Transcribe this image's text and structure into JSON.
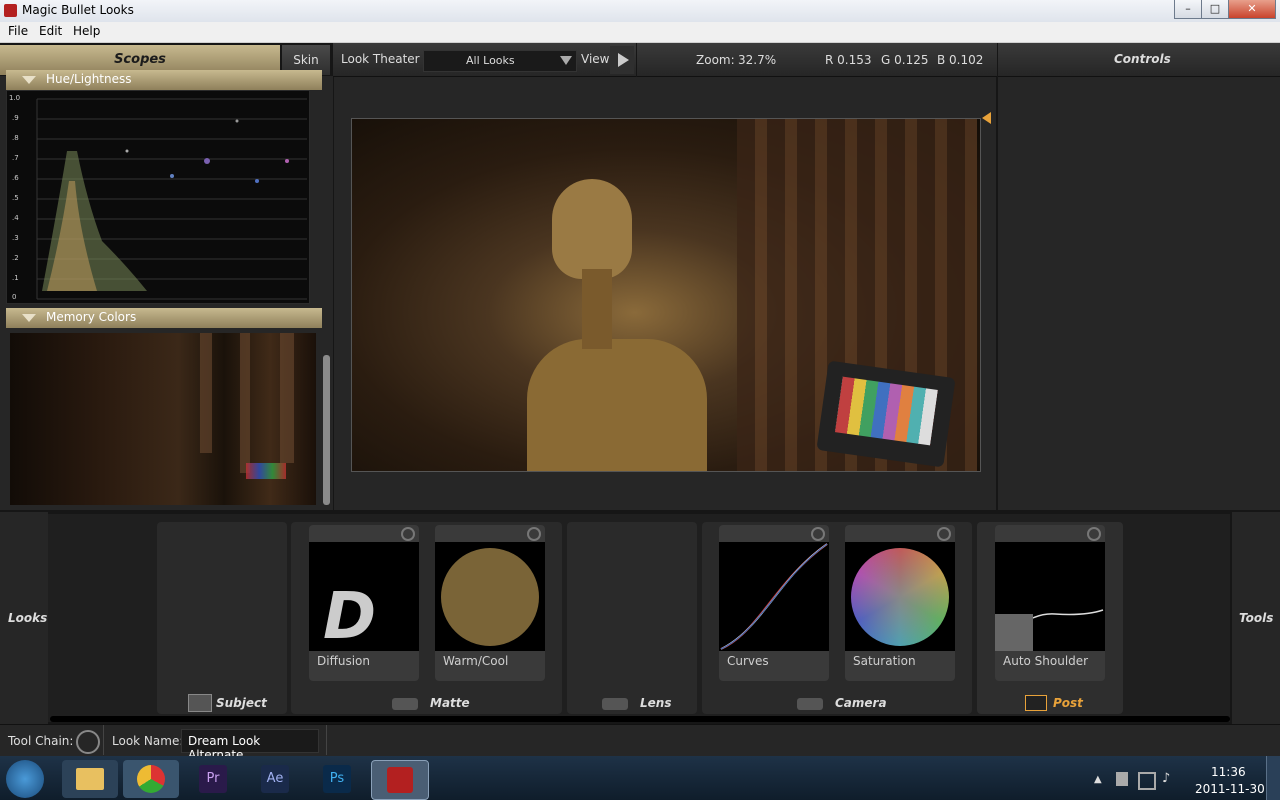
{
  "window": {
    "title": "Magic Bullet Looks"
  },
  "menu": [
    "File",
    "Edit",
    "Help"
  ],
  "tabs": {
    "scopes": "Scopes",
    "skin": "Skin"
  },
  "scopes": {
    "hue_section": "Hue/Lightness",
    "memory_section": "Memory Colors",
    "y_ticks": [
      "1.0",
      ".9",
      ".8",
      ".7",
      ".6",
      ".5",
      ".4",
      ".3",
      ".2",
      ".1",
      "0"
    ]
  },
  "viewer": {
    "look_theater": "Look Theater",
    "filter": "All Looks",
    "view": "View",
    "zoom_label": "Zoom:",
    "zoom_value": "32.7%",
    "r": "R 0.153",
    "g": "G 0.125",
    "b": "B 0.102"
  },
  "controls": {
    "title": "Controls"
  },
  "side": {
    "looks": "Looks",
    "tools": "Tools"
  },
  "tools": [
    {
      "name": "Diffusion"
    },
    {
      "name": "Warm/Cool"
    },
    {
      "name": "Curves"
    },
    {
      "name": "Saturation"
    },
    {
      "name": "Auto Shoulder"
    }
  ],
  "stages": [
    "Subject",
    "Matte",
    "Lens",
    "Camera",
    "Post"
  ],
  "bottom": {
    "tool_chain": "Tool Chain:",
    "look_name_label": "Look Name:",
    "look_name": "Dream Look Alternate"
  },
  "taskbar": {
    "apps": [
      "Pr",
      "Ae",
      "Ps"
    ],
    "time": "11:36",
    "date": "2011-11-30"
  },
  "colors": {
    "accent": "#e8a23a",
    "gold_header": "#b3a47a"
  }
}
